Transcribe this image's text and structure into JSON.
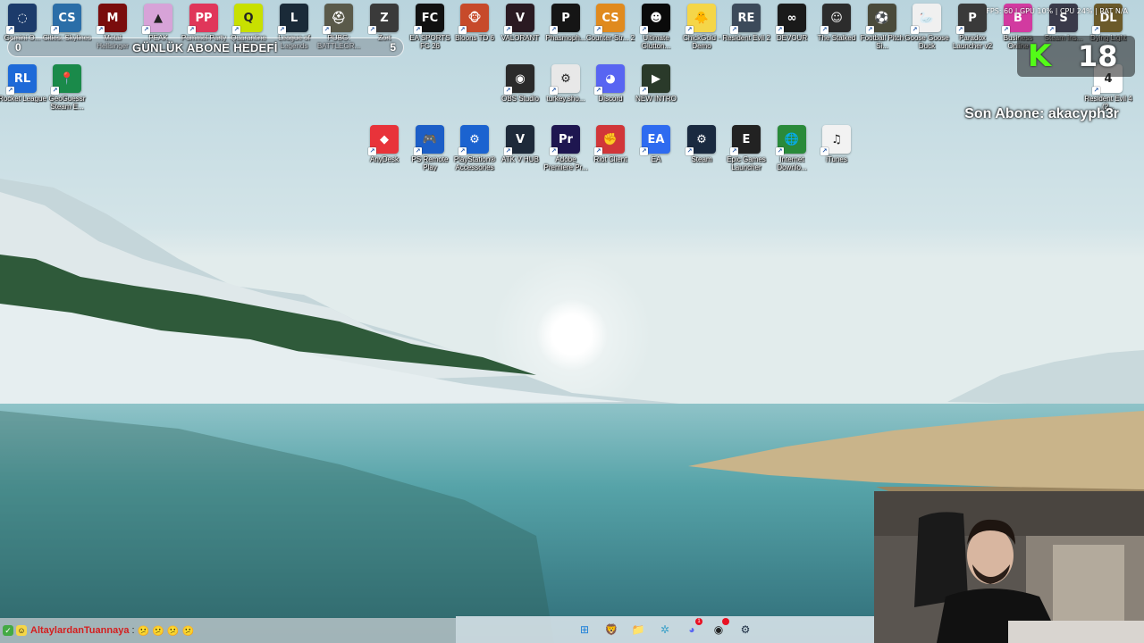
{
  "overlay": {
    "stats": "FPS: 60 | GPU 10% | CPU 24% | RAT N/A",
    "abone_title": "GÜNLÜK ABONE HEDEFİ",
    "abone_current": "0",
    "abone_target": "5",
    "kick_count": "18",
    "son_abone": "Son Abone: akacyph3r"
  },
  "desktop": {
    "row1": [
      {
        "label": "Gemini O...",
        "icon": "gemini-icon",
        "color": "#1c3b6b",
        "glyph": "◌"
      },
      {
        "label": "Cities: Skylines",
        "icon": "cities-skylines-icon",
        "color": "#2b6ea8",
        "glyph": "CS"
      },
      {
        "label": "Metal Hellsinger",
        "icon": "metal-hellsinger-icon",
        "color": "#7a0d0d",
        "glyph": "M"
      },
      {
        "label": "PEAK",
        "icon": "peak-icon",
        "color": "#d7a3d8",
        "glyph": "▲"
      },
      {
        "label": "Pummel Party",
        "icon": "pummel-party-icon",
        "color": "#e0365a",
        "glyph": "PP"
      },
      {
        "label": "Quarantine Zone",
        "icon": "quarantine-zone-icon",
        "color": "#c8e000",
        "glyph": "Q"
      },
      {
        "label": "League of Legends",
        "icon": "league-of-legends-icon",
        "color": "#1a2a38",
        "glyph": "L"
      },
      {
        "label": "PUBG: BATTLEGR...",
        "icon": "pubg-icon",
        "color": "#5a5a4a",
        "glyph": "⛑"
      },
      {
        "label": "Zort",
        "icon": "zort-icon",
        "color": "#3a3a3a",
        "glyph": "Z"
      },
      {
        "label": "EA SPORTS FC 26",
        "icon": "ea-fc26-icon",
        "color": "#111111",
        "glyph": "FC"
      },
      {
        "label": "Bloons TD 6",
        "icon": "bloons-td6-icon",
        "color": "#c74a2a",
        "glyph": "🐵"
      },
      {
        "label": "VALORANT",
        "icon": "valorant-icon",
        "color": "#2a1a22",
        "glyph": "V"
      },
      {
        "label": "Phasmoph...",
        "icon": "phasmophobia-icon",
        "color": "#151515",
        "glyph": "P"
      },
      {
        "label": "Counter-Str... 2",
        "icon": "counter-strike-2-icon",
        "color": "#e08a1e",
        "glyph": "CS"
      },
      {
        "label": "Ultimate Glutton...",
        "icon": "ultimate-glutton-icon",
        "color": "#0a0a0a",
        "glyph": "☻"
      },
      {
        "label": "ChickGold - Demo",
        "icon": "chickgold-icon",
        "color": "#f5d648",
        "glyph": "🐥"
      },
      {
        "label": "Resident Evil 2",
        "icon": "resident-evil-2-icon",
        "color": "#3c4a5a",
        "glyph": "RE"
      },
      {
        "label": "DEVOUR",
        "icon": "devour-icon",
        "color": "#1a1a1a",
        "glyph": "∞"
      },
      {
        "label": "The Stalked",
        "icon": "the-stalked-icon",
        "color": "#2c2c2c",
        "glyph": "☺"
      },
      {
        "label": "Football Pitch Si...",
        "icon": "football-pitch-icon",
        "color": "#4a4a3a",
        "glyph": "⚽"
      },
      {
        "label": "Goose Goose Duck",
        "icon": "goose-goose-duck-icon",
        "color": "#f0f0f0",
        "glyph": "🦢"
      },
      {
        "label": "Paradox Launcher v2",
        "icon": "paradox-launcher-icon",
        "color": "#3a3a3a",
        "glyph": "P"
      },
      {
        "label": "Business Online",
        "icon": "business-online-icon",
        "color": "#d23aa0",
        "glyph": "B"
      },
      {
        "label": "Steam Ins...",
        "icon": "steam-ins-icon",
        "color": "#3a3a4a",
        "glyph": "S"
      },
      {
        "label": "Dying Light",
        "icon": "dying-light-icon",
        "color": "#6b5a2a",
        "glyph": "DL"
      }
    ],
    "row2_left": [
      {
        "label": "Rocket League",
        "icon": "rocket-league-icon",
        "color": "#1e6ad8",
        "glyph": "RL"
      },
      {
        "label": "GeoGuessr Steam E...",
        "icon": "geoguessr-icon",
        "color": "#1a8a4a",
        "glyph": "📍"
      }
    ],
    "row2_mid": [
      {
        "label": "OBS Studio",
        "icon": "obs-studio-icon",
        "color": "#2a2a2a",
        "glyph": "◉"
      },
      {
        "label": "turkey.sho...",
        "icon": "turkey-shortcut-icon",
        "color": "#e8e8e8",
        "glyph": "⚙"
      },
      {
        "label": "Discord",
        "icon": "discord-icon",
        "color": "#5865f2",
        "glyph": "◕"
      },
      {
        "label": "NEW INTRO",
        "icon": "new-intro-icon",
        "color": "#2a3a2a",
        "glyph": "▶"
      }
    ],
    "resident_evil_right": {
      "label": "Resident Evil 4 (2...",
      "icon": "resident-evil-4-icon",
      "color": "#ffffff",
      "glyph": "4"
    },
    "row3": [
      {
        "label": "AnyDesk",
        "icon": "anydesk-icon",
        "color": "#e8333a",
        "glyph": "◆"
      },
      {
        "label": "PS Remote Play",
        "icon": "ps-remote-play-icon",
        "color": "#1c5ec7",
        "glyph": "🎮"
      },
      {
        "label": "PlayStation® Accessories",
        "icon": "playstation-accessories-icon",
        "color": "#1b63d0",
        "glyph": "⚙"
      },
      {
        "label": "ATK V HUB",
        "icon": "atk-v-hub-icon",
        "color": "#1e2a3a",
        "glyph": "V"
      },
      {
        "label": "Adobe Premiere Pr...",
        "icon": "premiere-pro-icon",
        "color": "#1e1650",
        "glyph": "Pr"
      },
      {
        "label": "Riot Client",
        "icon": "riot-client-icon",
        "color": "#d13639",
        "glyph": "✊"
      },
      {
        "label": "EA",
        "icon": "ea-icon",
        "color": "#2e6bf0",
        "glyph": "EA"
      },
      {
        "label": "Steam",
        "icon": "steam-icon",
        "color": "#1a2a40",
        "glyph": "⚙"
      },
      {
        "label": "Epic Games Launcher",
        "icon": "epic-games-icon",
        "color": "#222222",
        "glyph": "E"
      },
      {
        "label": "Internet Downlo...",
        "icon": "internet-download-manager-icon",
        "color": "#2a8a3a",
        "glyph": "🌐"
      },
      {
        "label": "iTunes",
        "icon": "itunes-icon",
        "color": "#f2f2f2",
        "glyph": "♫"
      }
    ]
  },
  "chat": {
    "username": "AltaylardanTuannaya",
    "separator": ":",
    "message": "😕😕😕😕"
  },
  "taskbar": [
    {
      "name": "windows-start-icon",
      "glyph": "⊞",
      "color": "#1c7fd8"
    },
    {
      "name": "brave-browser-icon",
      "glyph": "🦁",
      "color": "#f05a24"
    },
    {
      "name": "file-explorer-icon",
      "glyph": "📁",
      "color": "#f4c542"
    },
    {
      "name": "settings-app-icon",
      "glyph": "✲",
      "color": "#3aa0c8"
    },
    {
      "name": "discord-taskbar-icon",
      "glyph": "◕",
      "color": "#5865f2",
      "badge": "1"
    },
    {
      "name": "obs-taskbar-icon",
      "glyph": "◉",
      "color": "#222222",
      "badge": ""
    },
    {
      "name": "steam-taskbar-icon",
      "glyph": "⚙",
      "color": "#1a2a40"
    }
  ]
}
